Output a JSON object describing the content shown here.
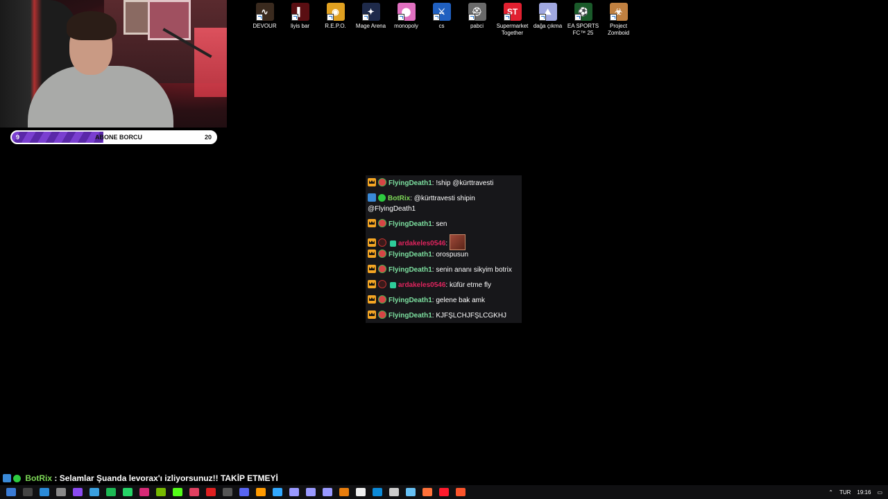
{
  "subscription_bar": {
    "label": "ABONE BORCU",
    "current": "9",
    "target": "20",
    "progress": 0.45
  },
  "desktop_icons": [
    {
      "label": "DEVOUR",
      "icon": "devour-icon",
      "color": "#3a2a1e",
      "glyph": "∿"
    },
    {
      "label": "liyis bar",
      "icon": "liyis-bar-icon",
      "color": "#5a0e12",
      "glyph": "▌"
    },
    {
      "label": "R.E.P.O.",
      "icon": "repo-icon",
      "color": "#e0a020",
      "glyph": "◉"
    },
    {
      "label": "Mage Arena",
      "icon": "mage-arena-icon",
      "color": "#1e2a4a",
      "glyph": "✦"
    },
    {
      "label": "monopoly",
      "icon": "monopoly-icon",
      "color": "#e070c0",
      "glyph": "⬤"
    },
    {
      "label": "cs",
      "icon": "counter-strike-icon",
      "color": "#2060c0",
      "glyph": "⚔"
    },
    {
      "label": "pabci",
      "icon": "pubg-icon",
      "color": "#6a6a6a",
      "glyph": "⛑"
    },
    {
      "label": "Supermarket Together",
      "icon": "supermarket-together-icon",
      "color": "#e02030",
      "glyph": "ST"
    },
    {
      "label": "dağa çıkma",
      "icon": "daga-cikma-icon",
      "color": "#a0a8e0",
      "glyph": "⛰"
    },
    {
      "label": "EA SPORTS FC™ 25",
      "icon": "ea-fc25-icon",
      "color": "#1a5a2a",
      "glyph": "⚽"
    },
    {
      "label": "Project Zomboid",
      "icon": "project-zomboid-icon",
      "color": "#c08040",
      "glyph": "☣"
    }
  ],
  "chat": [
    {
      "user": "FlyingDeath1",
      "message": "!ship @kürttravesti",
      "style": "green",
      "badges": [
        "crown",
        "tomato"
      ]
    },
    {
      "user": "BotRix",
      "message": "@kürttravesti shipin @FlyingDeath1",
      "style": "bot",
      "badges": [
        "mod",
        "verified"
      ]
    },
    {
      "user": "FlyingDeath1",
      "message": "sen",
      "style": "green",
      "badges": [
        "crown",
        "tomato"
      ]
    },
    {
      "user": "ardakeles0546",
      "message": "",
      "style": "red",
      "badges": [
        "crown",
        "redcircle",
        "gift"
      ],
      "emote": true
    },
    {
      "user": "FlyingDeath1",
      "message": "orospusun",
      "style": "green",
      "badges": [
        "crown",
        "tomato"
      ]
    },
    {
      "user": "FlyingDeath1",
      "message": "senin ananı sikyim botrix",
      "style": "green",
      "badges": [
        "crown",
        "tomato"
      ]
    },
    {
      "user": "ardakeles0546",
      "message": "küfür etme fly",
      "style": "red",
      "badges": [
        "crown",
        "redcircle",
        "gift"
      ]
    },
    {
      "user": "FlyingDeath1",
      "message": "gelene bak amk",
      "style": "green",
      "badges": [
        "crown",
        "tomato"
      ]
    },
    {
      "user": "FlyingDeath1",
      "message": "KJFŞLCHJFŞLCGKHJ",
      "style": "green",
      "badges": [
        "crown",
        "tomato"
      ]
    }
  ],
  "bot_announcement": {
    "user": "BotRix",
    "message": "Selamlar Şuanda levorax'ı izliyorsunuz!! TAKİP ETMEYİ UNUTMAYIN!"
  },
  "taskbar": {
    "apps": [
      {
        "icon": "start-icon",
        "color": "#3a7bd5"
      },
      {
        "icon": "search-icon",
        "color": "#444"
      },
      {
        "icon": "vscode-icon",
        "color": "#2a8ad8"
      },
      {
        "icon": "chatgpt-icon",
        "color": "#888"
      },
      {
        "icon": "twitch-icon",
        "color": "#8a4af0"
      },
      {
        "icon": "stream-icon",
        "color": "#3aa0e0"
      },
      {
        "icon": "spotify-icon",
        "color": "#1db954"
      },
      {
        "icon": "whatsapp-icon",
        "color": "#25d366"
      },
      {
        "icon": "instagram-icon",
        "color": "#d62976"
      },
      {
        "icon": "nvidia-icon",
        "color": "#76b900"
      },
      {
        "icon": "kick-icon",
        "color": "#53fc18"
      },
      {
        "icon": "tiktok-icon",
        "color": "#e04060"
      },
      {
        "icon": "record-icon",
        "color": "#e02020"
      },
      {
        "icon": "obs-icon",
        "color": "#555"
      },
      {
        "icon": "discord-icon",
        "color": "#5865f2"
      },
      {
        "icon": "illustrator-icon",
        "color": "#ff9a00"
      },
      {
        "icon": "photoshop-icon",
        "color": "#31a8ff"
      },
      {
        "icon": "media-encoder-icon",
        "color": "#9999ff"
      },
      {
        "icon": "premiere-icon",
        "color": "#9999ff"
      },
      {
        "icon": "after-effects-icon",
        "color": "#9999ff"
      },
      {
        "icon": "blender-icon",
        "color": "#e87d0d"
      },
      {
        "icon": "capcut-icon",
        "color": "#eee"
      },
      {
        "icon": "edge-icon",
        "color": "#0c8ad8"
      },
      {
        "icon": "epic-icon",
        "color": "#ccc"
      },
      {
        "icon": "steam-icon",
        "color": "#66c0f4"
      },
      {
        "icon": "firefox-icon",
        "color": "#ff7139"
      },
      {
        "icon": "opera-icon",
        "color": "#ff1b2d"
      },
      {
        "icon": "brave-icon",
        "color": "#fb542b"
      }
    ],
    "language": "TUR",
    "time": "19:16"
  }
}
